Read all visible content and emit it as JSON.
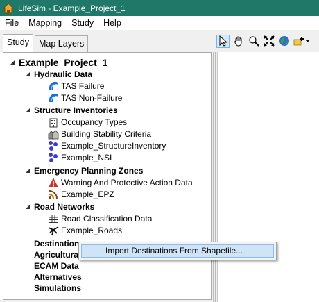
{
  "window": {
    "title": "LifeSim - Example_Project_1",
    "title_color": "#1f7868"
  },
  "menubar": {
    "items": [
      "File",
      "Mapping",
      "Study",
      "Help"
    ]
  },
  "tabs": [
    "Study",
    "Map Layers"
  ],
  "toolbar": {
    "icons": [
      "pointer-icon",
      "pan-hand-icon",
      "zoom-icon",
      "full-extent-icon",
      "globe-icon",
      "add-layer-icon"
    ]
  },
  "tree": {
    "root": "Example_Project_1",
    "hydraulic": {
      "label": "Hydraulic Data",
      "items": [
        "TAS Failure",
        "TAS Non-Failure"
      ]
    },
    "structures": {
      "label": "Structure Inventories",
      "items": [
        "Occupancy Types",
        "Building Stability Criteria",
        "Example_StructureInventory",
        "Example_NSI"
      ]
    },
    "epz": {
      "label": "Emergency Planning Zones",
      "items": [
        "Warning And Protective Action Data",
        "Example_EPZ"
      ]
    },
    "roads": {
      "label": "Road Networks",
      "items": [
        "Road Classification Data",
        "Example_Roads"
      ]
    },
    "destinations": "Destinations",
    "agricultural": "Agricultural",
    "ecam": "ECAM Data",
    "alternatives": "Alternatives",
    "simulations": "Simulations"
  },
  "context_menu": {
    "item": "Import Destinations From Shapefile..."
  }
}
